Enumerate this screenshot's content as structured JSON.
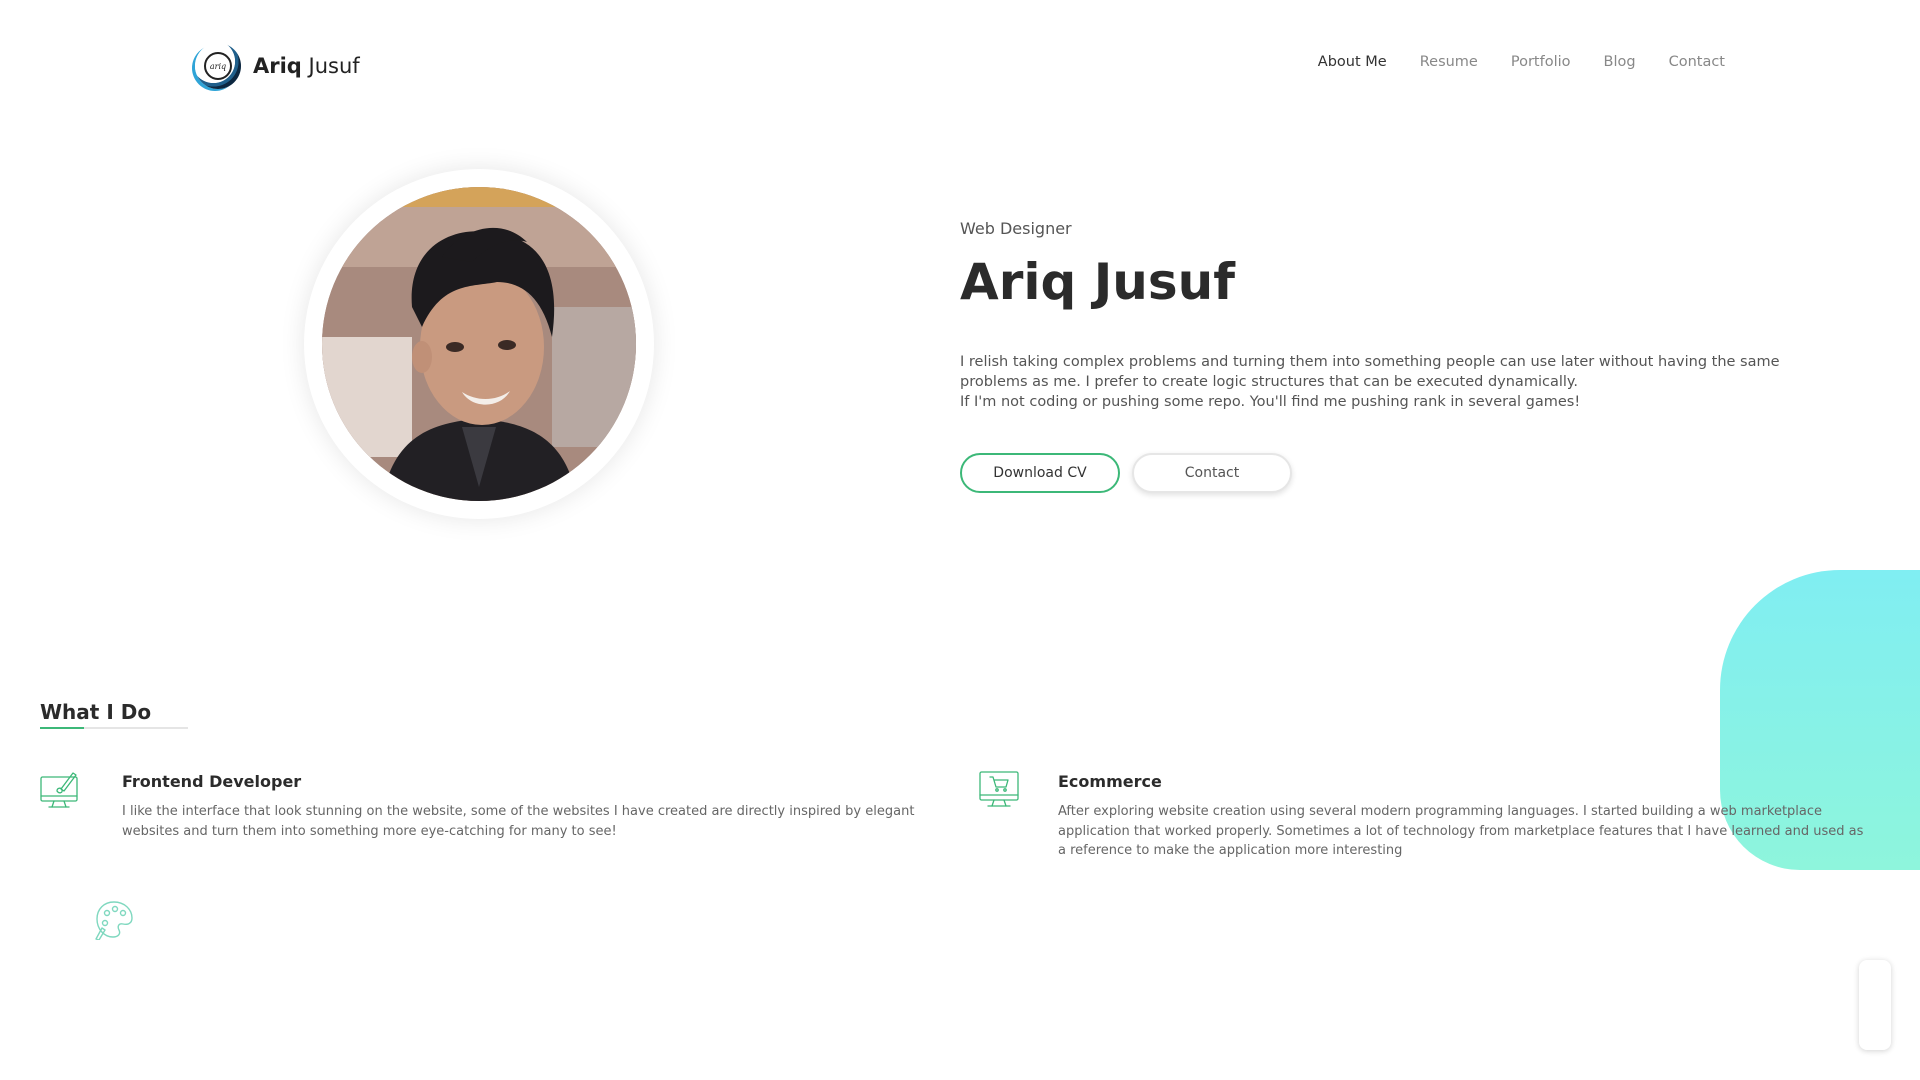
{
  "header": {
    "brand_first": "Ariq",
    "brand_last": " Jusuf",
    "logo_text": "ariq",
    "nav": [
      {
        "label": "About Me",
        "active": true
      },
      {
        "label": "Resume",
        "active": false
      },
      {
        "label": "Portfolio",
        "active": false
      },
      {
        "label": "Blog",
        "active": false
      },
      {
        "label": "Contact",
        "active": false
      }
    ]
  },
  "hero": {
    "role": "Web Designer",
    "name": "Ariq Jusuf",
    "bio_line1": "I relish taking complex problems and turning them into something people can use later without having the same problems as me. I prefer to create logic structures that can be executed dynamically.",
    "bio_line2": "If I'm not coding or pushing some repo. You'll find me pushing rank in several games!",
    "download_label": "Download CV",
    "contact_label": "Contact"
  },
  "services": {
    "title": "What I Do",
    "items": [
      {
        "icon": "monitor-brush-icon",
        "title": "Frontend Developer",
        "description": "I like the interface that look stunning on the website, some of the websites I have created are directly inspired by elegant websites and turn them into something more eye-catching for many to see!"
      },
      {
        "icon": "monitor-cart-icon",
        "title": "Ecommerce",
        "description": "After exploring website creation using several modern programming languages. I started building a web marketplace application that worked properly. Sometimes a lot of technology from marketplace features that I have learned and used as a reference to make the application more interesting"
      }
    ],
    "extra_icon": "palette-icon"
  },
  "colors": {
    "accent": "#3cb878",
    "blob_top": "#80eef2",
    "blob_bottom": "#8ef5dc",
    "text_dark": "#2b2b2b",
    "text_muted": "#888888"
  }
}
